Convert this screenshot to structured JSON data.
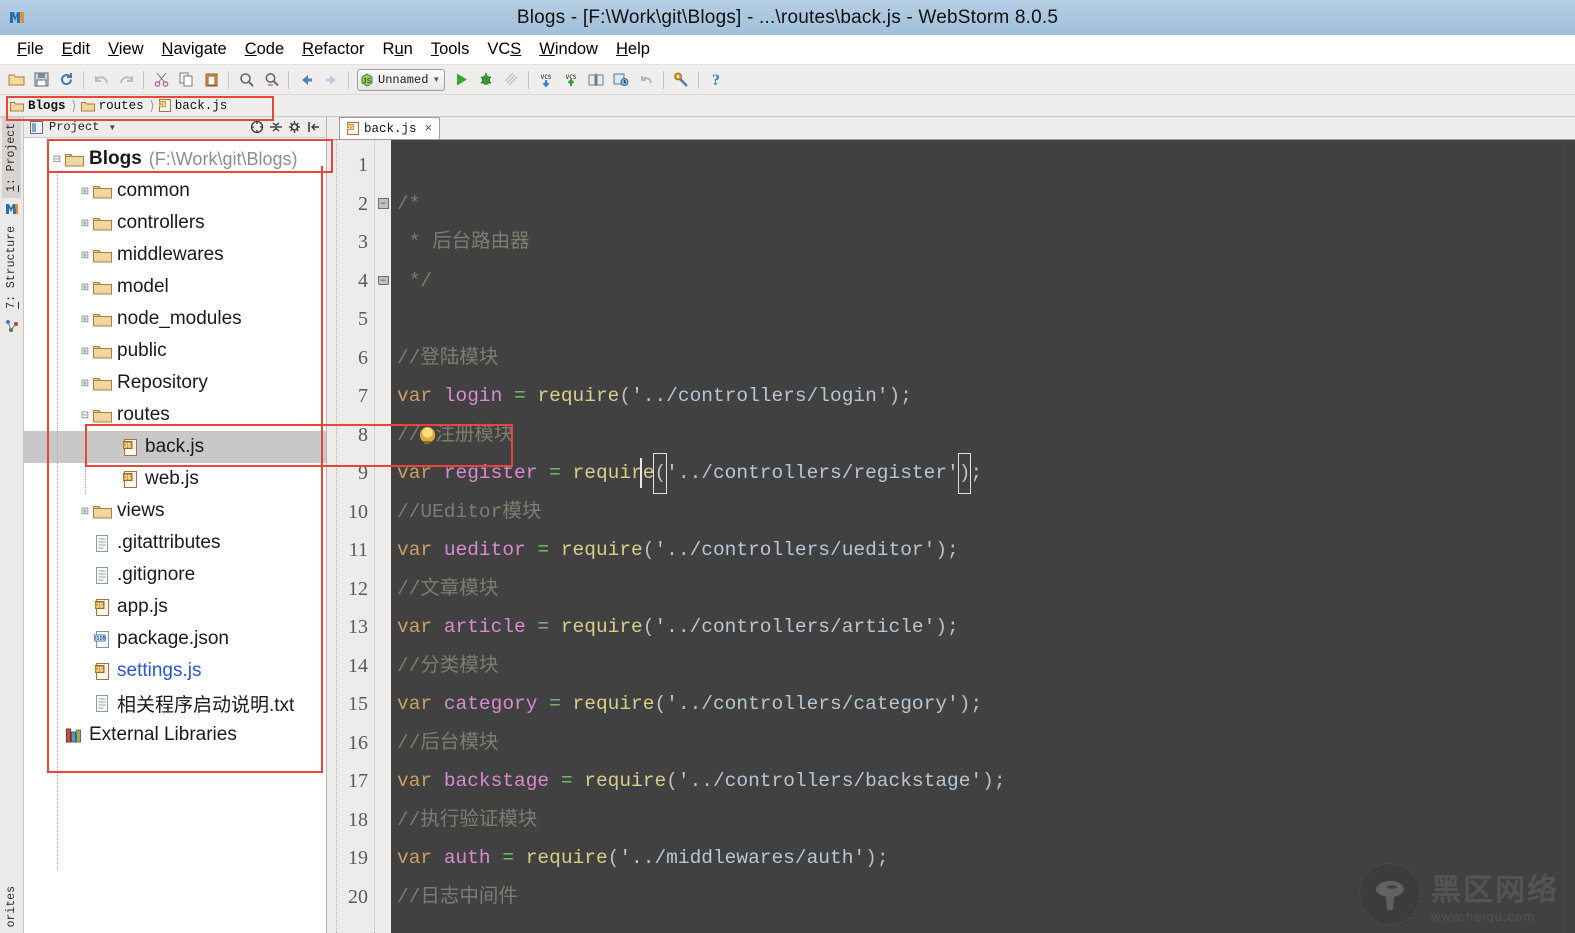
{
  "window": {
    "title": "Blogs - [F:\\Work\\git\\Blogs] - ...\\routes\\back.js - WebStorm 8.0.5",
    "app_logo": "webstorm-logo"
  },
  "menubar": {
    "items": [
      {
        "label": "File",
        "mnemonic": "F"
      },
      {
        "label": "Edit",
        "mnemonic": "E"
      },
      {
        "label": "View",
        "mnemonic": "V"
      },
      {
        "label": "Navigate",
        "mnemonic": "N"
      },
      {
        "label": "Code",
        "mnemonic": "C"
      },
      {
        "label": "Refactor",
        "mnemonic": "R"
      },
      {
        "label": "Run",
        "mnemonic": "u"
      },
      {
        "label": "Tools",
        "mnemonic": "T"
      },
      {
        "label": "VCS",
        "mnemonic": "S"
      },
      {
        "label": "Window",
        "mnemonic": "W"
      },
      {
        "label": "Help",
        "mnemonic": "H"
      }
    ]
  },
  "toolbar": {
    "buttons": [
      "open-folder-icon",
      "save-all-icon",
      "sync-refresh-icon",
      "undo-icon",
      "redo-icon",
      "cut-icon",
      "copy-icon",
      "paste-icon",
      "find-icon",
      "replace-icon",
      "back-icon",
      "forward-icon"
    ],
    "run_config": {
      "label": "Unnamed",
      "icon": "js-config-icon"
    },
    "run_buttons": [
      "run-icon",
      "debug-icon",
      "coverage-icon"
    ],
    "vcs_buttons": [
      "vcs-update-icon",
      "vcs-commit-icon",
      "vcs-compare-icon",
      "vcs-history-icon",
      "vcs-rollback-icon"
    ],
    "settings_button": "settings-wrench-icon",
    "help_button": "help-icon"
  },
  "breadcrumb": {
    "items": [
      {
        "label": "Blogs",
        "icon": "folder-icon",
        "bold": true
      },
      {
        "label": "routes",
        "icon": "folder-icon",
        "bold": false
      },
      {
        "label": "back.js",
        "icon": "js-file-icon",
        "bold": false
      }
    ]
  },
  "toolstrip": {
    "tabs": [
      {
        "label": "1: Project",
        "number": "1",
        "active": true
      },
      {
        "label": "7: Structure",
        "number": "7",
        "active": false
      }
    ],
    "icons": [
      "webstorm-icon",
      "structure-icon"
    ],
    "bottom_tab": "orites"
  },
  "project_panel": {
    "header": {
      "title": "Project",
      "view_icon": "project-view-icon",
      "caret": "▾",
      "buttons": [
        "scroll-from-source-icon",
        "collapse-all-icon",
        "settings-gear-icon",
        "hide-panel-icon"
      ]
    },
    "tree": [
      {
        "label": "Blogs",
        "sub": "(F:\\Work\\git\\Blogs)",
        "icon": "folder-icon",
        "depth": 0,
        "twisty": "⊟",
        "bold": true,
        "selected": false,
        "vcs": false
      },
      {
        "label": "common",
        "sub": "",
        "icon": "folder-icon",
        "depth": 1,
        "twisty": "⊞",
        "bold": false,
        "selected": false,
        "vcs": false
      },
      {
        "label": "controllers",
        "sub": "",
        "icon": "folder-icon",
        "depth": 1,
        "twisty": "⊞",
        "bold": false,
        "selected": false,
        "vcs": false
      },
      {
        "label": "middlewares",
        "sub": "",
        "icon": "folder-icon",
        "depth": 1,
        "twisty": "⊞",
        "bold": false,
        "selected": false,
        "vcs": false
      },
      {
        "label": "model",
        "sub": "",
        "icon": "folder-icon",
        "depth": 1,
        "twisty": "⊞",
        "bold": false,
        "selected": false,
        "vcs": false
      },
      {
        "label": "node_modules",
        "sub": "",
        "icon": "folder-icon",
        "depth": 1,
        "twisty": "⊞",
        "bold": false,
        "selected": false,
        "vcs": false
      },
      {
        "label": "public",
        "sub": "",
        "icon": "folder-icon",
        "depth": 1,
        "twisty": "⊞",
        "bold": false,
        "selected": false,
        "vcs": false
      },
      {
        "label": "Repository",
        "sub": "",
        "icon": "folder-icon",
        "depth": 1,
        "twisty": "⊞",
        "bold": false,
        "selected": false,
        "vcs": false
      },
      {
        "label": "routes",
        "sub": "",
        "icon": "folder-icon",
        "depth": 1,
        "twisty": "⊟",
        "bold": false,
        "selected": false,
        "vcs": false
      },
      {
        "label": "back.js",
        "sub": "",
        "icon": "js-file-icon",
        "depth": 2,
        "twisty": "",
        "bold": false,
        "selected": true,
        "vcs": false
      },
      {
        "label": "web.js",
        "sub": "",
        "icon": "js-file-icon",
        "depth": 2,
        "twisty": "",
        "bold": false,
        "selected": false,
        "vcs": false
      },
      {
        "label": "views",
        "sub": "",
        "icon": "folder-icon",
        "depth": 1,
        "twisty": "⊞",
        "bold": false,
        "selected": false,
        "vcs": false
      },
      {
        "label": ".gitattributes",
        "sub": "",
        "icon": "text-file-icon",
        "depth": 1,
        "twisty": "",
        "bold": false,
        "selected": false,
        "vcs": false
      },
      {
        "label": ".gitignore",
        "sub": "",
        "icon": "text-file-icon",
        "depth": 1,
        "twisty": "",
        "bold": false,
        "selected": false,
        "vcs": false
      },
      {
        "label": "app.js",
        "sub": "",
        "icon": "js-file-icon",
        "depth": 1,
        "twisty": "",
        "bold": false,
        "selected": false,
        "vcs": false
      },
      {
        "label": "package.json",
        "sub": "",
        "icon": "json-file-icon",
        "depth": 1,
        "twisty": "",
        "bold": false,
        "selected": false,
        "vcs": false
      },
      {
        "label": "settings.js",
        "sub": "",
        "icon": "js-file-icon",
        "depth": 1,
        "twisty": "",
        "bold": false,
        "selected": false,
        "vcs": true
      },
      {
        "label": "相关程序启动说明.txt",
        "sub": "",
        "icon": "text-file-icon",
        "depth": 1,
        "twisty": "",
        "bold": false,
        "selected": false,
        "vcs": false
      },
      {
        "label": "External Libraries",
        "sub": "",
        "icon": "library-icon",
        "depth": 0,
        "twisty": "",
        "bold": false,
        "selected": false,
        "vcs": false
      }
    ]
  },
  "editor": {
    "tab": {
      "label": "back.js",
      "icon": "js-file-icon",
      "close": "×"
    },
    "lines": [
      {
        "no": "1",
        "fold": "",
        "segments": []
      },
      {
        "no": "2",
        "fold": "start",
        "segments": [
          {
            "t": "/*",
            "c": "cmt"
          }
        ]
      },
      {
        "no": "3",
        "fold": "",
        "segments": [
          {
            "t": " * 后台路由器",
            "c": "cmt"
          }
        ]
      },
      {
        "no": "4",
        "fold": "end",
        "segments": [
          {
            "t": " */",
            "c": "cmt"
          }
        ]
      },
      {
        "no": "5",
        "fold": "",
        "segments": []
      },
      {
        "no": "6",
        "fold": "",
        "segments": [
          {
            "t": "//登陆模块",
            "c": "cmt"
          }
        ]
      },
      {
        "no": "7",
        "fold": "",
        "segments": [
          {
            "t": "var ",
            "c": "key"
          },
          {
            "t": "login",
            "c": "var"
          },
          {
            "t": " = ",
            "c": "op"
          },
          {
            "t": "require",
            "c": "fn"
          },
          {
            "t": "(",
            "c": "punc"
          },
          {
            "t": "'../controllers/login'",
            "c": "str"
          },
          {
            "t": ")",
            "c": "punc"
          },
          {
            "t": ";",
            "c": "punc"
          }
        ]
      },
      {
        "no": "8",
        "fold": "",
        "segments": [
          {
            "t": "//",
            "c": "cmt"
          },
          {
            "t": " ",
            "c": "bulb"
          },
          {
            "t": "注册模块",
            "c": "cmt"
          }
        ]
      },
      {
        "no": "9",
        "fold": "",
        "segments": [
          {
            "t": "var ",
            "c": "key"
          },
          {
            "t": "register",
            "c": "var"
          },
          {
            "t": " = ",
            "c": "op"
          },
          {
            "t": "require",
            "c": "fn"
          },
          {
            "t": "(",
            "c": "punc-hl"
          },
          {
            "t": "'../controllers/register'",
            "c": "str"
          },
          {
            "t": ")",
            "c": "punc-hl"
          },
          {
            "t": ";",
            "c": "punc"
          }
        ]
      },
      {
        "no": "10",
        "fold": "",
        "segments": [
          {
            "t": "//UEditor模块",
            "c": "cmt"
          }
        ]
      },
      {
        "no": "11",
        "fold": "",
        "segments": [
          {
            "t": "var ",
            "c": "key"
          },
          {
            "t": "ueditor",
            "c": "var"
          },
          {
            "t": " = ",
            "c": "op"
          },
          {
            "t": "require",
            "c": "fn"
          },
          {
            "t": "(",
            "c": "punc"
          },
          {
            "t": "'../controllers/ueditor'",
            "c": "str"
          },
          {
            "t": ")",
            "c": "punc"
          },
          {
            "t": ";",
            "c": "punc"
          }
        ]
      },
      {
        "no": "12",
        "fold": "",
        "segments": [
          {
            "t": "//文章模块",
            "c": "cmt"
          }
        ]
      },
      {
        "no": "13",
        "fold": "",
        "segments": [
          {
            "t": "var ",
            "c": "key"
          },
          {
            "t": "article",
            "c": "var"
          },
          {
            "t": " = ",
            "c": "op"
          },
          {
            "t": "require",
            "c": "fn"
          },
          {
            "t": "(",
            "c": "punc"
          },
          {
            "t": "'../controllers/article'",
            "c": "str"
          },
          {
            "t": ")",
            "c": "punc"
          },
          {
            "t": ";",
            "c": "punc"
          }
        ]
      },
      {
        "no": "14",
        "fold": "",
        "segments": [
          {
            "t": "//分类模块",
            "c": "cmt"
          }
        ]
      },
      {
        "no": "15",
        "fold": "",
        "segments": [
          {
            "t": "var ",
            "c": "key"
          },
          {
            "t": "category",
            "c": "var"
          },
          {
            "t": " = ",
            "c": "op"
          },
          {
            "t": "require",
            "c": "fn"
          },
          {
            "t": "(",
            "c": "punc"
          },
          {
            "t": "'../controllers/category'",
            "c": "str"
          },
          {
            "t": ")",
            "c": "punc"
          },
          {
            "t": ";",
            "c": "punc"
          }
        ]
      },
      {
        "no": "16",
        "fold": "",
        "segments": [
          {
            "t": "//后台模块",
            "c": "cmt"
          }
        ]
      },
      {
        "no": "17",
        "fold": "",
        "segments": [
          {
            "t": "var ",
            "c": "key"
          },
          {
            "t": "backstage",
            "c": "var"
          },
          {
            "t": " = ",
            "c": "op"
          },
          {
            "t": "require",
            "c": "fn"
          },
          {
            "t": "(",
            "c": "punc"
          },
          {
            "t": "'../controllers/backstage'",
            "c": "str"
          },
          {
            "t": ")",
            "c": "punc"
          },
          {
            "t": ";",
            "c": "punc"
          }
        ]
      },
      {
        "no": "18",
        "fold": "",
        "segments": [
          {
            "t": "//执行验证模块",
            "c": "cmt"
          }
        ]
      },
      {
        "no": "19",
        "fold": "",
        "segments": [
          {
            "t": "var ",
            "c": "key"
          },
          {
            "t": "auth",
            "c": "var"
          },
          {
            "t": " = ",
            "c": "op"
          },
          {
            "t": "require",
            "c": "fn"
          },
          {
            "t": "(",
            "c": "punc"
          },
          {
            "t": "'../middlewares/auth'",
            "c": "str"
          },
          {
            "t": ")",
            "c": "punc"
          },
          {
            "t": ";",
            "c": "punc"
          }
        ]
      },
      {
        "no": "20",
        "fold": "",
        "segments": [
          {
            "t": "//日志中间件",
            "c": "cmt"
          }
        ]
      }
    ]
  },
  "watermark": {
    "cn": "黑区网络",
    "url": "www.heiqu.com",
    "logo": "mushroom-icon"
  },
  "colors": {
    "titlebar": "#a9c6de",
    "editor_bg": "#414141",
    "gutter_bg": "#eeecea",
    "selection": "#c8c8c8",
    "annotation": "#e8453c",
    "vcs_blue": "#2b56c6",
    "keyword": "#cc9f62",
    "variable": "#d98ad3",
    "operator": "#79c46b",
    "function": "#d7cf87",
    "string": "#b7c6d3",
    "comment": "#7d7d6f"
  }
}
